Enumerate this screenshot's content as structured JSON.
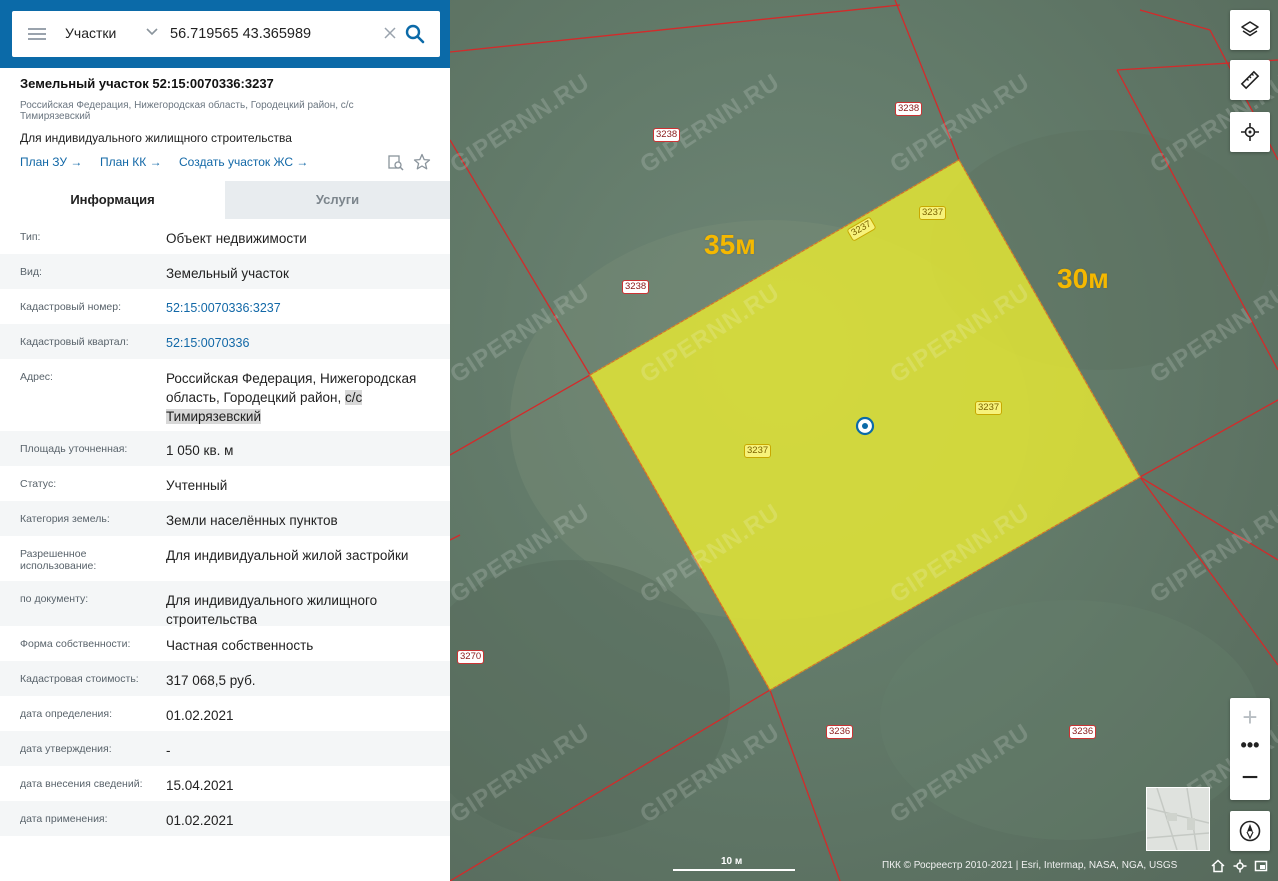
{
  "search": {
    "layer": "Участки",
    "query": "56.719565 43.365989"
  },
  "object": {
    "title": "Земельный участок 52:15:0070336:3237",
    "address": "Российская Федерация, Нижегородская область, Городецкий район, с/с Тимирязевский",
    "purpose": "Для индивидуального жилищного строительства",
    "links": [
      "План ЗУ →",
      "План КК →",
      "Создать участок ЖС →"
    ]
  },
  "tabs": {
    "info": "Информация",
    "services": "Услуги"
  },
  "properties": [
    {
      "label": "Тип:",
      "value": "Объект недвижимости"
    },
    {
      "label": "Вид:",
      "value": "Земельный участок"
    },
    {
      "label": "Кадастровый номер:",
      "value": "52:15:0070336:3237"
    },
    {
      "label": "Кадастровый квартал:",
      "value": "52:15:0070336"
    },
    {
      "label": "Адрес:",
      "value": "Российская Федерация, Нижегородская область, Городецкий район, ",
      "value_highlight": "с/с Тимирязевский"
    },
    {
      "label": "Площадь уточненная:",
      "value": "1 050 кв. м"
    },
    {
      "label": "Статус:",
      "value": "Учтенный"
    },
    {
      "label": "Категория земель:",
      "value": "Земли населённых пунктов"
    },
    {
      "label": "Разрешенное использование:",
      "value": "Для индивидуальной жилой застройки"
    },
    {
      "label": "по документу:",
      "value": "Для индивидуального жилищного строительства"
    },
    {
      "label": "Форма собственности:",
      "value": "Частная собственность"
    },
    {
      "label": "Кадастровая стоимость:",
      "value": "317 068,5 руб."
    },
    {
      "label": "дата определения:",
      "value": "01.02.2021"
    },
    {
      "label": "дата утверждения:",
      "value": "-"
    },
    {
      "label": "дата внесения сведений:",
      "value": "15.04.2021"
    },
    {
      "label": "дата применения:",
      "value": "01.02.2021"
    }
  ],
  "map": {
    "dimension_top": "35м",
    "dimension_right": "30м",
    "plot_labels": [
      "3238",
      "3238",
      "3238",
      "3237",
      "3237",
      "3237",
      "3237",
      "3270",
      "3236",
      "3236"
    ],
    "watermark": "GIPERNN.RU",
    "scale": "10 м",
    "attribution": "ПКК © Росреестр 2010-2021 | Esri, Intermap, NASA, NGA, USGS",
    "parcel_fill": "#e3e635",
    "boundary_color": "#d42a2a",
    "accent": "#0b6aa8"
  }
}
